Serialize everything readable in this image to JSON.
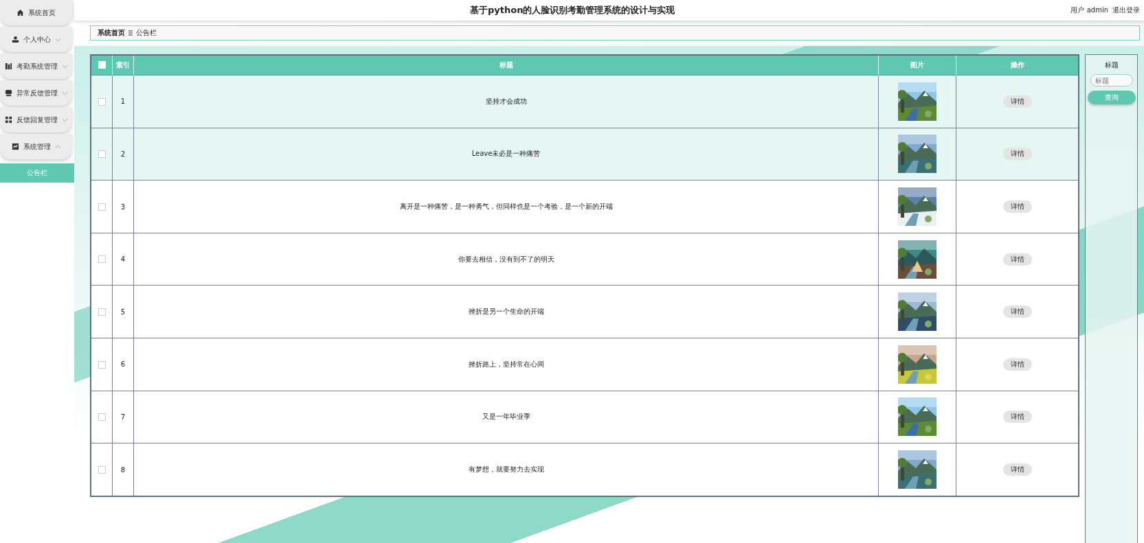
{
  "sidebar": {
    "items": [
      {
        "label": "系统首页"
      },
      {
        "label": "个人中心",
        "expanded": false
      },
      {
        "label": "考勤系统管理",
        "expanded": false
      },
      {
        "label": "异常反馈管理",
        "expanded": false
      },
      {
        "label": "反馈回复管理",
        "expanded": false
      },
      {
        "label": "系统管理",
        "expanded": true,
        "children": [
          {
            "label": "公告栏",
            "selected": true
          }
        ]
      }
    ]
  },
  "header": {
    "title": "基于python的人脸识别考勤管理系统的设计与实现",
    "user_label": "用户 admin",
    "logout": "退出登录"
  },
  "breadcrumb": [
    "系统首页",
    "公告栏"
  ],
  "table": {
    "columns": [
      "索引",
      "标题",
      "图片",
      "操作"
    ],
    "select_all": false,
    "rows": [
      {
        "index": "1",
        "title": "坚持才会成功",
        "checked": false,
        "highlighted": true,
        "action": "详情"
      },
      {
        "index": "2",
        "title": "Leave未必是一种痛苦",
        "checked": false,
        "highlighted": true,
        "action": "详情"
      },
      {
        "index": "3",
        "title": "离开是一种痛苦，是一种勇气，但同样也是一个考验，是一个新的开端",
        "checked": false,
        "highlighted": false,
        "action": "详情"
      },
      {
        "index": "4",
        "title": "你要去相信，没有到不了的明天",
        "checked": false,
        "highlighted": false,
        "action": "详情"
      },
      {
        "index": "5",
        "title": "挫折是另一个生命的开端",
        "checked": false,
        "highlighted": false,
        "action": "详情"
      },
      {
        "index": "6",
        "title": "挫折路上，坚持常在心间",
        "checked": false,
        "highlighted": false,
        "action": "详情"
      },
      {
        "index": "7",
        "title": "又是一年毕业季",
        "checked": false,
        "highlighted": false,
        "action": "详情"
      },
      {
        "index": "8",
        "title": "有梦想，就要努力去实现",
        "checked": false,
        "highlighted": false,
        "action": "详情"
      }
    ]
  },
  "search": {
    "label": "标题",
    "placeholder": "标题",
    "button": "查询"
  }
}
